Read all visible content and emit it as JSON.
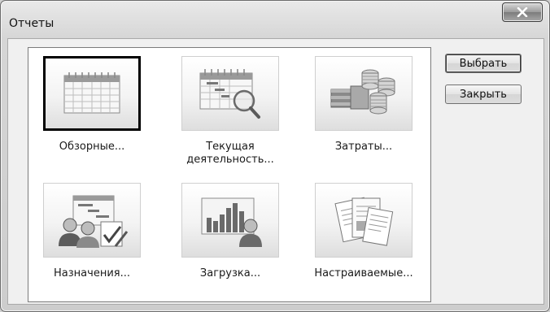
{
  "window": {
    "title": "Отчеты"
  },
  "reports": [
    {
      "label": "Обзорные...",
      "icon": "calendar-grid-icon",
      "selected": true
    },
    {
      "label": "Текущая деятельность...",
      "icon": "calendar-magnifier-icon",
      "selected": false
    },
    {
      "label": "Затраты...",
      "icon": "coin-stacks-icon",
      "selected": false
    },
    {
      "label": "Назначения...",
      "icon": "people-assignment-icon",
      "selected": false
    },
    {
      "label": "Загрузка...",
      "icon": "bar-chart-people-icon",
      "selected": false
    },
    {
      "label": "Настраиваемые...",
      "icon": "documents-icon",
      "selected": false
    }
  ],
  "buttons": {
    "select": "Выбрать",
    "close": "Закрыть"
  }
}
